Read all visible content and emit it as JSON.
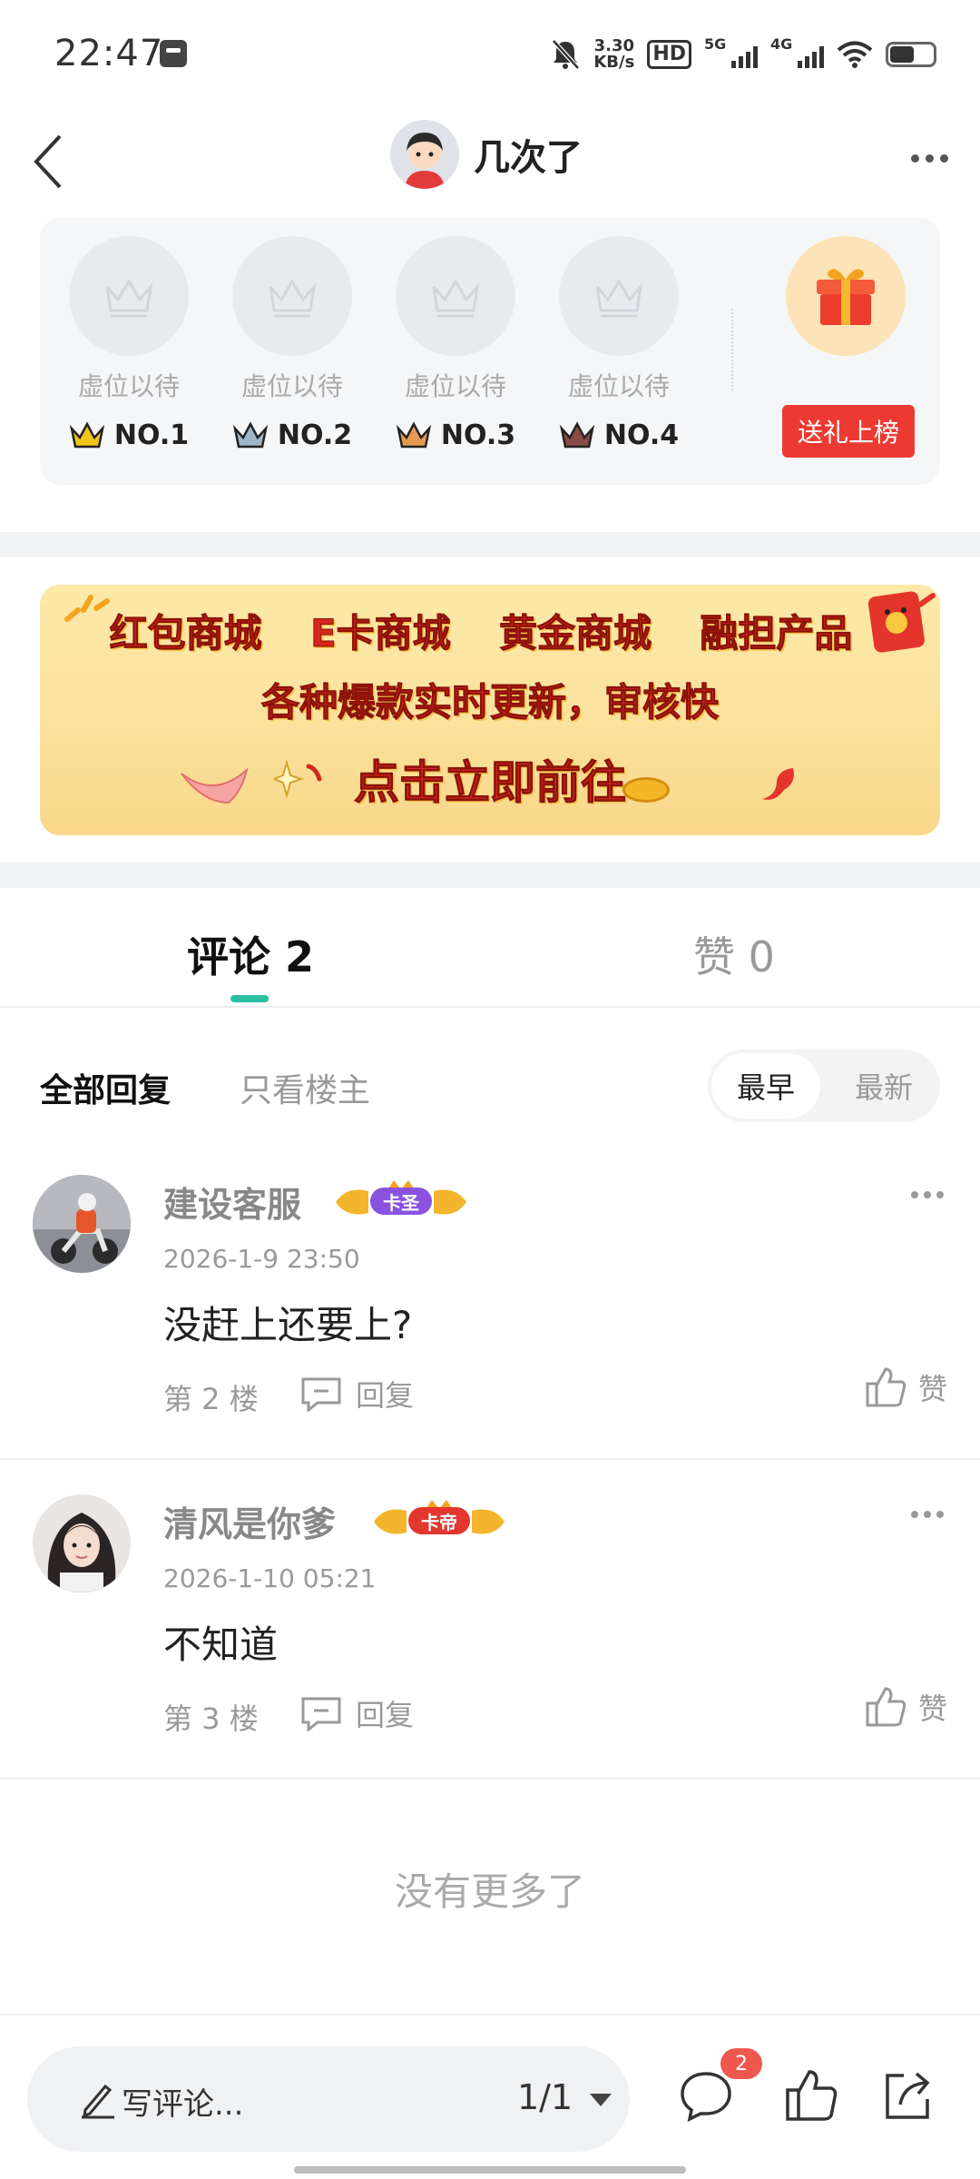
{
  "status_bar": {
    "time": "22:47",
    "net_speed_value": "3.30",
    "net_speed_unit": "KB/s",
    "hd_label": "HD",
    "sim1_label": "5G",
    "sim2_label": "4G"
  },
  "header": {
    "title": "几次了"
  },
  "gift_rank": {
    "slots": [
      {
        "status": "虚位以待",
        "rank": "NO.1",
        "crown_color": "#f3c51b"
      },
      {
        "status": "虚位以待",
        "rank": "NO.2",
        "crown_color": "#9fb6c9"
      },
      {
        "status": "虚位以待",
        "rank": "NO.3",
        "crown_color": "#e59a4f"
      },
      {
        "status": "虚位以待",
        "rank": "NO.4",
        "crown_color": "#8a4a45"
      }
    ],
    "gift_button": "送礼上榜"
  },
  "banner": {
    "items": [
      "红包商城",
      "E卡商城",
      "黄金商城",
      "融担产品"
    ],
    "subtitle": "各种爆款实时更新，审核快",
    "cta": "点击立即前往"
  },
  "tabs": {
    "comments": "评论 2",
    "likes": "赞 0"
  },
  "filter": {
    "all": "全部回复",
    "host_only": "只看楼主",
    "sort_earliest": "最早",
    "sort_latest": "最新"
  },
  "comments": [
    {
      "name": "建设客服",
      "badge": "卡圣",
      "badge_color": "#8a52e0",
      "time": "2026-1-9 23:50",
      "text": "没赶上还要上?",
      "floor": "第 2 楼",
      "reply": "回复",
      "like": "赞"
    },
    {
      "name": "清风是你爹",
      "badge": "卡帝",
      "badge_color": "#e2362f",
      "time": "2026-1-10 05:21",
      "text": "不知道",
      "floor": "第 3 楼",
      "reply": "回复",
      "like": "赞"
    }
  ],
  "no_more": "没有更多了",
  "bottom_bar": {
    "placeholder": "写评论...",
    "page": "1/1",
    "comment_count_badge": "2"
  },
  "colors": {
    "accent": "#2bbfa4",
    "gift_red": "#ec3a32",
    "badge_red": "#f0574f"
  }
}
